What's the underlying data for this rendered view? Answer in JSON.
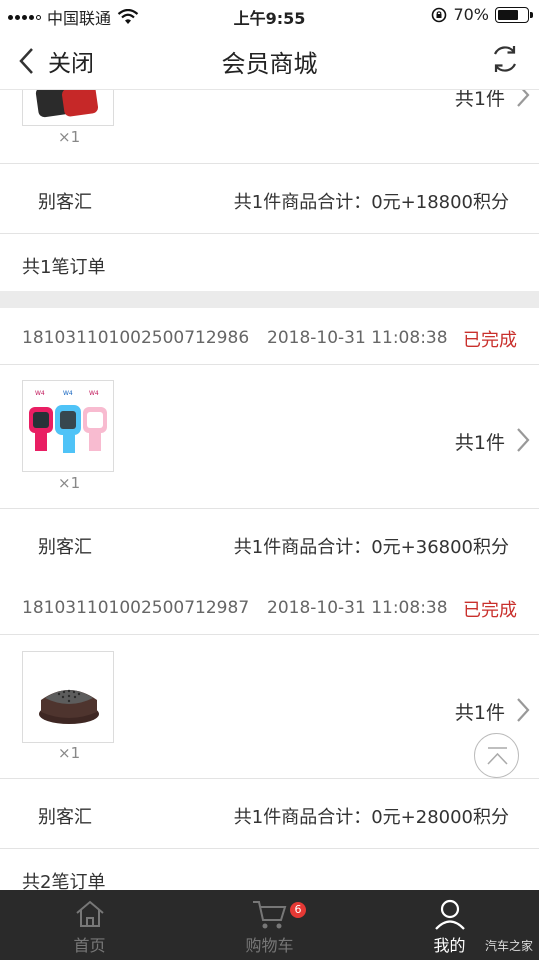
{
  "status_bar": {
    "carrier": "中国联通",
    "time": "上午9:55",
    "battery": "70%",
    "battery_level": 0.7
  },
  "header": {
    "back_label": "关闭",
    "title": "会员商城"
  },
  "group1": {
    "item": {
      "qty": "×1",
      "count": "共1件"
    },
    "summary": {
      "shop": "别客汇",
      "total": "共1件商品合计：0元+18800积分"
    },
    "orders_count": "共1笔订单"
  },
  "group2": {
    "orders": [
      {
        "order_no": "181031101002500712986",
        "time": "2018-10-31 11:08:38",
        "status": "已完成",
        "thumb_caption": [
          "W4",
          "W4",
          "W4"
        ],
        "qty": "×1",
        "count": "共1件",
        "shop": "别客汇",
        "total": "共1件商品合计：0元+36800积分"
      },
      {
        "order_no": "181031101002500712987",
        "time": "2018-10-31 11:08:38",
        "status": "已完成",
        "qty": "×1",
        "count": "共1件",
        "shop": "别客汇",
        "total": "共1件商品合计：0元+28000积分"
      }
    ],
    "orders_count": "共2笔订单"
  },
  "tabbar": {
    "tabs": [
      {
        "label": "首页",
        "icon": "home-icon"
      },
      {
        "label": "购物车",
        "icon": "cart-icon",
        "badge": "6"
      },
      {
        "label": "我的",
        "icon": "user-icon"
      }
    ]
  },
  "watermark": "汽车之家",
  "colors": {
    "status": "#c9302c",
    "tabbar_bg": "#2a2a2a",
    "tab_active": "#ffffff",
    "tab_inactive": "#777777",
    "badge": "#e53935"
  }
}
